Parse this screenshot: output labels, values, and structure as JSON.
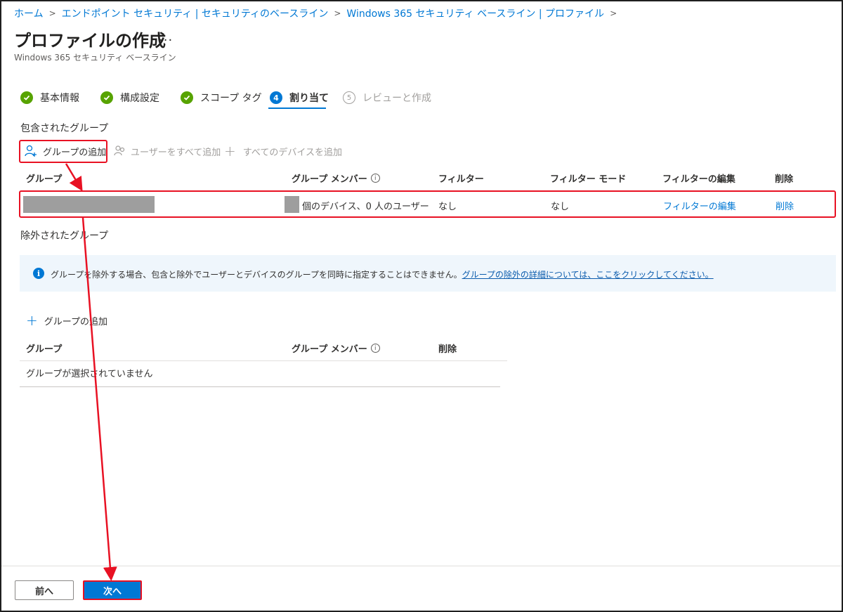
{
  "breadcrumb": {
    "items": [
      "ホーム",
      "エンドポイント セキュリティ | セキュリティのベースライン",
      "Windows 365 セキュリティ ベースライン | プロファイル"
    ]
  },
  "page": {
    "title": "プロファイルの作成",
    "more": "...",
    "subtitle": "Windows 365 セキュリティ ベースライン"
  },
  "steps": [
    {
      "label": "基本情報",
      "state": "complete"
    },
    {
      "label": "構成設定",
      "state": "complete"
    },
    {
      "label": "スコープ タグ",
      "state": "complete"
    },
    {
      "number": "4",
      "label": "割り当て",
      "state": "active"
    },
    {
      "number": "5",
      "label": "レビューと作成",
      "state": "disabled"
    }
  ],
  "included": {
    "section_label": "包含されたグループ",
    "toolbar": {
      "add_group": "グループの追加",
      "add_all_users": "ユーザーをすべて追加",
      "add_all_devices": "すべてのデバイスを追加"
    },
    "columns": [
      "グループ",
      "グループ メンバー",
      "フィルター",
      "フィルター モード",
      "フィルターの編集",
      "削除"
    ],
    "rows": [
      {
        "members_suffix": "個のデバイス、0 人のユーザー",
        "filter": "なし",
        "filter_mode": "なし",
        "edit_filter": "フィルターの編集",
        "delete": "削除"
      }
    ]
  },
  "excluded": {
    "section_label": "除外されたグループ",
    "info_text": "グループを除外する場合、包含と除外でユーザーとデバイスのグループを同時に指定することはできません。",
    "info_link": "グループの除外の詳細については、ここをクリックしてください。",
    "add_group": "グループの追加",
    "columns": [
      "グループ",
      "グループ メンバー",
      "削除"
    ],
    "empty_text": "グループが選択されていません"
  },
  "footer": {
    "prev": "前へ",
    "next": "次へ"
  },
  "colors": {
    "accent": "#0078d4",
    "success": "#57a300",
    "highlight": "#e81123",
    "info_bg": "#eff6fc"
  }
}
